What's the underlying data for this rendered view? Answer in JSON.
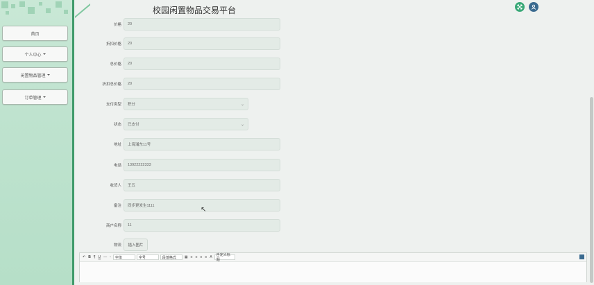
{
  "header": {
    "title": "校园闲置物品交易平台",
    "expand_icon": "expand-icon",
    "user_icon": "user-icon"
  },
  "sidebar": {
    "items": [
      {
        "label": "首页"
      },
      {
        "label": "个人中心"
      },
      {
        "label": "闲置物品管理"
      },
      {
        "label": "订单管理"
      }
    ]
  },
  "form": {
    "price": {
      "label": "价格",
      "value": "20"
    },
    "discount_price": {
      "label": "折扣价格",
      "value": "20"
    },
    "total_price": {
      "label": "总价格",
      "value": "20"
    },
    "discount_total": {
      "label": "折扣总价格",
      "value": "20"
    },
    "pay_type": {
      "label": "支付类型",
      "value": "积分"
    },
    "status": {
      "label": "状态",
      "value": "已支付"
    },
    "address": {
      "label": "地址",
      "value": "上海浦东11号"
    },
    "phone": {
      "label": "电话",
      "value": "13922222333"
    },
    "receiver": {
      "label": "收货人",
      "value": "王五"
    },
    "remark": {
      "label": "备注",
      "value": "同步更发生1111"
    },
    "account": {
      "label": "商户名称",
      "value": "11"
    },
    "logistics": {
      "label": "物流",
      "button": "插入图片"
    }
  },
  "editor": {
    "toolbar": {
      "bold": "B",
      "underline": "U",
      "font": "字体",
      "size": "字号",
      "paragraph": "段落格式",
      "color": "A",
      "custom": "自定义标题"
    }
  },
  "colors": {
    "sidebar_bg": "#c9e8d6",
    "accent": "#3f9a6a"
  }
}
